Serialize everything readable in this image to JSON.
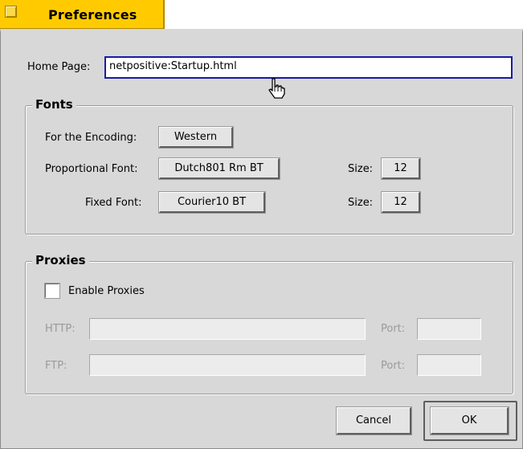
{
  "window": {
    "title": "Preferences"
  },
  "home_page": {
    "label": "Home Page:",
    "value": "netpositive:Startup.html"
  },
  "fonts": {
    "group_title": "Fonts",
    "encoding_label": "For the Encoding:",
    "encoding_value": "Western",
    "proportional_label": "Proportional Font:",
    "proportional_value": "Dutch801 Rm BT",
    "proportional_size_label": "Size:",
    "proportional_size_value": "12",
    "fixed_label": "Fixed Font:",
    "fixed_value": "Courier10 BT",
    "fixed_size_label": "Size:",
    "fixed_size_value": "12"
  },
  "proxies": {
    "group_title": "Proxies",
    "enable_label": "Enable Proxies",
    "enabled": false,
    "http_label": "HTTP:",
    "http_value": "",
    "http_port_label": "Port:",
    "http_port_value": "",
    "ftp_label": "FTP:",
    "ftp_value": "",
    "ftp_port_label": "Port:",
    "ftp_port_value": ""
  },
  "buttons": {
    "cancel": "Cancel",
    "ok": "OK"
  },
  "icons": {
    "close": "close-box-icon",
    "cursor": "hand-pointer-icon"
  }
}
